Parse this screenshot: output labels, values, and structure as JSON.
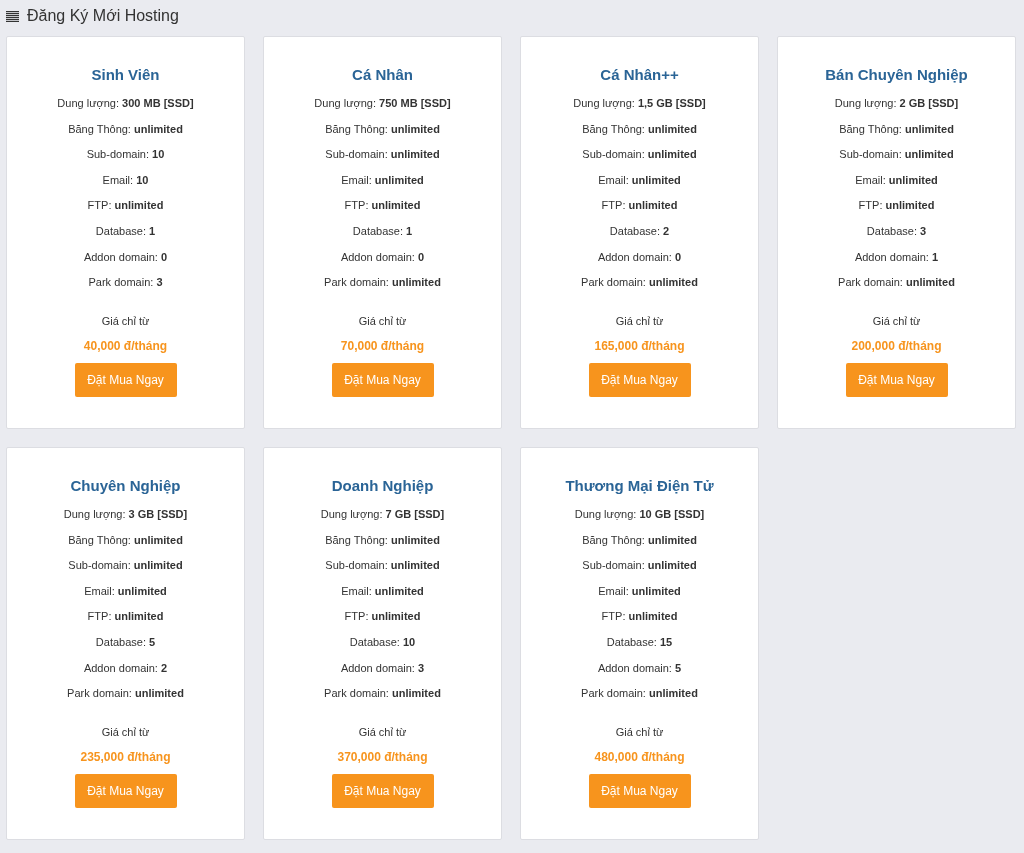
{
  "header": {
    "title": "Đăng Ký Mới Hosting"
  },
  "plans": [
    {
      "name": "Sinh Viên",
      "features": [
        "Dung lượng: **300 MB [SSD]**",
        "Băng Thông: **unlimited**",
        "Sub-domain: **10**",
        "Email: **10**",
        "FTP: **unlimited**",
        "Database: **1**",
        "Addon domain: **0**",
        "Park domain: **3**"
      ],
      "price_label": "Giá chỉ từ",
      "price": "40,000 đ/tháng",
      "button": "Đặt Mua Ngay"
    },
    {
      "name": "Cá Nhân",
      "features": [
        "Dung lượng: **750 MB [SSD]**",
        "Băng Thông: **unlimited**",
        "Sub-domain: **unlimited**",
        "Email: **unlimited**",
        "FTP: **unlimited**",
        "Database: **1**",
        "Addon domain: **0**",
        "Park domain: **unlimited**"
      ],
      "price_label": "Giá chỉ từ",
      "price": "70,000 đ/tháng",
      "button": "Đặt Mua Ngay"
    },
    {
      "name": "Cá Nhân++",
      "features": [
        "Dung lượng: **1,5 GB [SSD]**",
        "Băng Thông: **unlimited**",
        "Sub-domain: **unlimited**",
        "Email: **unlimited**",
        "FTP: **unlimited**",
        "Database: **2**",
        "Addon domain: **0**",
        "Park domain: **unlimited**"
      ],
      "price_label": "Giá chỉ từ",
      "price": "165,000 đ/tháng",
      "button": "Đặt Mua Ngay"
    },
    {
      "name": "Bán Chuyên Nghiệp",
      "features": [
        "Dung lượng: **2 GB [SSD]**",
        "Băng Thông: **unlimited**",
        "Sub-domain: **unlimited**",
        "Email: **unlimited**",
        "FTP: **unlimited**",
        "Database: **3**",
        "Addon domain: **1**",
        "Park domain: **unlimited**"
      ],
      "price_label": "Giá chỉ từ",
      "price": "200,000 đ/tháng",
      "button": "Đặt Mua Ngay"
    },
    {
      "name": "Chuyên Nghiệp",
      "features": [
        "Dung lượng: **3 GB [SSD]**",
        "Băng Thông: **unlimited**",
        "Sub-domain: **unlimited**",
        "Email: **unlimited**",
        "FTP: **unlimited**",
        "Database: **5**",
        "Addon domain: **2**",
        "Park domain: **unlimited**"
      ],
      "price_label": "Giá chỉ từ",
      "price": "235,000 đ/tháng",
      "button": "Đặt Mua Ngay"
    },
    {
      "name": "Doanh Nghiệp",
      "features": [
        "Dung lượng: **7 GB [SSD]**",
        "Băng Thông: **unlimited**",
        "Sub-domain: **unlimited**",
        "Email: **unlimited**",
        "FTP: **unlimited**",
        "Database: **10**",
        "Addon domain: **3**",
        "Park domain: **unlimited**"
      ],
      "price_label": "Giá chỉ từ",
      "price": "370,000 đ/tháng",
      "button": "Đặt Mua Ngay"
    },
    {
      "name": "Thương Mại Điện Tử",
      "features": [
        "Dung lượng: **10 GB [SSD]**",
        "Băng Thông: **unlimited**",
        "Sub-domain: **unlimited**",
        "Email: **unlimited**",
        "FTP: **unlimited**",
        "Database: **15**",
        "Addon domain: **5**",
        "Park domain: **unlimited**"
      ],
      "price_label": "Giá chỉ từ",
      "price": "480,000 đ/tháng",
      "button": "Đặt Mua Ngay"
    }
  ]
}
